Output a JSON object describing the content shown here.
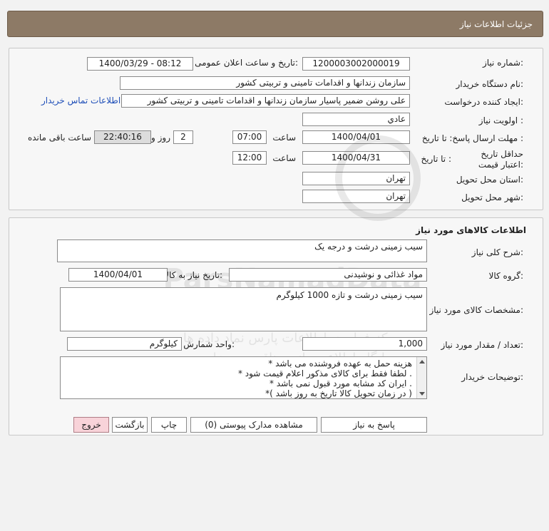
{
  "header": {
    "title": "جزئیات اطلاعات نیاز"
  },
  "info": {
    "need_number_label": "شماره نیاز:",
    "need_number": "1200003002000019",
    "announce_label": "تاریخ و ساعت اعلان عمومی:",
    "announce_value": "1400/03/29 - 08:12",
    "buyer_org_label": "نام دستگاه خریدار:",
    "buyer_org": "سازمان زندانها و اقدامات تامینی و تربیتی کشور",
    "requester_label": "ایجاد کننده درخواست:",
    "requester": "علی روشن ضمیر پاسیار سازمان زندانها و اقدامات تامینی و تربیتی کشور",
    "contact_link": "اطلاعات تماس خریدار",
    "priority_label": "اولویت نیاز :",
    "priority": "عادي",
    "deadline_label": "مهلت ارسال پاسخ: تا تاریخ :",
    "deadline_date": "1400/04/01",
    "time_label": "ساعت",
    "deadline_time": "07:00",
    "days_value": "2",
    "days_label": "روز و",
    "remaining_time": "22:40:16",
    "remaining_label": "ساعت باقی مانده",
    "validity_label": "حداقل تاریخ اعتبار قیمت:",
    "validity_to_label": "تا تاریخ :",
    "validity_date": "1400/04/31",
    "validity_time": "12:00",
    "province_label": "استان محل تحویل:",
    "province": "تهران",
    "city_label": "شهر محل تحویل:",
    "city": "تهران"
  },
  "goods": {
    "section_title": "اطلاعات کالاهای مورد نیاز",
    "description_label": "شرح کلی نیاز:",
    "description": "سیب زمینی درشت و درجه یک",
    "group_label": "گروه کالا:",
    "group": "مواد غذائی و نوشیدنی",
    "need_date_label": "تاریخ نیاز به کالا:",
    "need_date": "1400/04/01",
    "spec_label": "مشخصات کالای مورد نیاز:",
    "spec": "سیب زمینی درشت و تازه 1000 کیلوگرم",
    "qty_label": "تعداد / مقدار مورد نیاز:",
    "qty": "1,000",
    "unit_label": "واحد شمارش:",
    "unit": "کیلوگرم",
    "notes_label": "توضیحات خریدار:",
    "notes": [
      "هزینه حمل به عهده فروشنده می باشد *",
      ". لطفا فقط برای کالای مذکور اعلام قیمت شود *",
      ". ایران کد مشابه مورد قبول نمی باشد *",
      "( در زمان تحویل کالا تاریخ به روز باشد )*"
    ]
  },
  "actions": {
    "reply": "پاسخ به نیاز",
    "attachments": "مشاهده مدارک پیوستی (0)",
    "print": "چاپ",
    "back": "بازگشت",
    "exit": "خروج"
  },
  "watermark": {
    "name": "ParsNamadData",
    "line1": "پارس نماد داده ها",
    "line2": "مرکز فرآوری اطلاعات پارس نماد داده ها",
    "line3": "پایگاه اطلاع رسانی مناقصه و مزایده",
    "phone": "۰۲۱-۸۸۳۴۹۶۷۰"
  },
  "colors": {
    "header": "#8d7a66",
    "contact_link": "#1f4fb8",
    "exit_button": "#f8d3d9"
  }
}
